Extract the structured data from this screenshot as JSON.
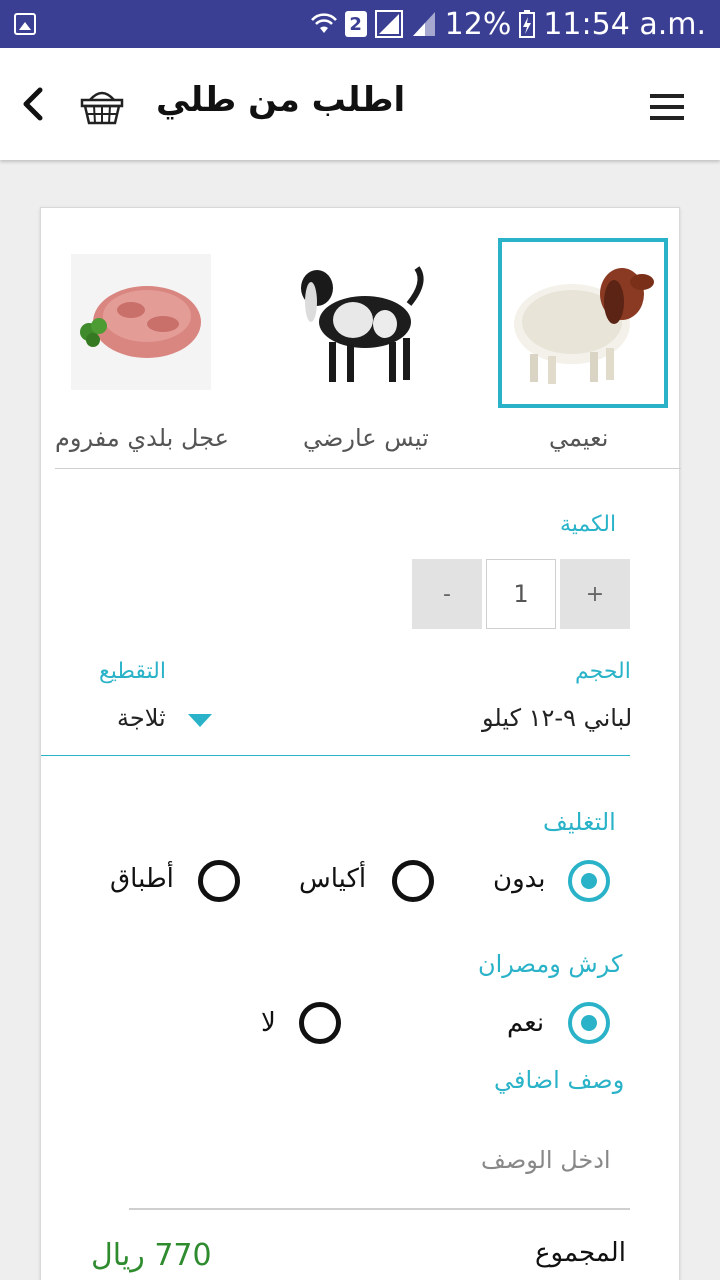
{
  "status_bar": {
    "battery": "12%",
    "time": "11:54 a.m.",
    "sim_number": "2",
    "icons": [
      "gallery-icon",
      "wifi-icon",
      "sim-icon",
      "signal-icon",
      "battery-icon"
    ]
  },
  "app_bar": {
    "title": "اطلب من طلي",
    "icons": [
      "back-chevron-icon",
      "basket-icon",
      "menu-icon"
    ]
  },
  "products": [
    {
      "name": "نعيمي",
      "selected": true,
      "icon": "naimi-sheep-image"
    },
    {
      "name": "تيس عارضي",
      "selected": false,
      "icon": "goat-image"
    },
    {
      "name": "عجل بلدي مفروم",
      "selected": false,
      "icon": "minced-meat-image"
    }
  ],
  "quantity": {
    "label": "الكمية",
    "plus": "+",
    "value": "1",
    "minus": "-"
  },
  "size": {
    "label": "الحجم",
    "value": "لباني ٩-١٢ كيلو"
  },
  "cutting": {
    "label": "التقطيع",
    "value": "ثلاجة"
  },
  "packaging": {
    "label": "التغليف",
    "options": [
      "بدون",
      "أكياس",
      "أطباق"
    ],
    "selected": "بدون"
  },
  "tripe": {
    "label": "كرش ومصران",
    "options": [
      "نعم",
      "لا"
    ],
    "selected": "نعم"
  },
  "extra_description": {
    "label": "وصف اضافي",
    "placeholder": "ادخل الوصف"
  },
  "total": {
    "label": "المجموع",
    "value": "770 ريال"
  },
  "colors": {
    "status_bar": "#3a3f94",
    "accent": "#2ab3c8",
    "price": "#2e8b2e"
  }
}
